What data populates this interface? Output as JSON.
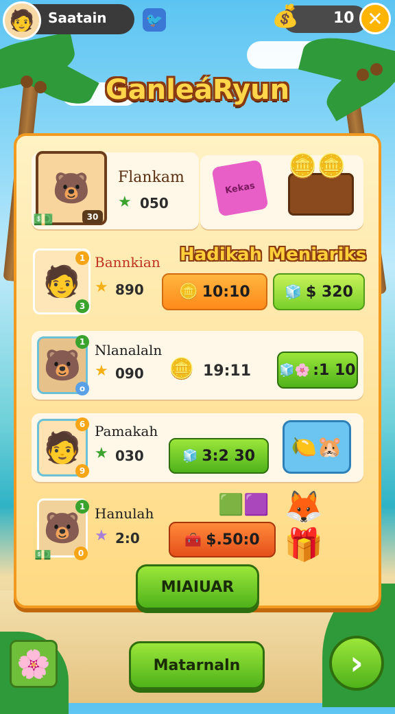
{
  "topbar": {
    "player_name": "Saatain",
    "coin_count": "10",
    "close_symbol": "✕"
  },
  "title": "GanleáRyun",
  "featured": {
    "name": "Flankam",
    "score": "050",
    "avatar_badge": "30",
    "gift_box_label": "Kekas"
  },
  "section_title": "Hadikah Meniariks",
  "rows": [
    {
      "name": "Bannkian",
      "score": "890",
      "reward_value": "10:10",
      "price": "$ 320",
      "badge": "1"
    },
    {
      "name": "Nlanalaln",
      "score": "090",
      "reward_value": "19:11",
      "price": ":1 10",
      "badge": "1"
    },
    {
      "name": "Pamakah",
      "score": "030",
      "reward_value": "3:2 30",
      "badge": "6"
    },
    {
      "name": "Hanulah",
      "score": "2:0",
      "reward_value": "$.50:0",
      "badge": "1"
    }
  ],
  "actions": {
    "main_button": "MIAIUAR",
    "bottom_button": "Matarnaln",
    "next_symbol": "›"
  },
  "colors": {
    "panel_border": "#f29a1f",
    "accent_green": "#4fb21a",
    "accent_orange": "#ff8a1a",
    "title_fill": "#ffd54a"
  }
}
